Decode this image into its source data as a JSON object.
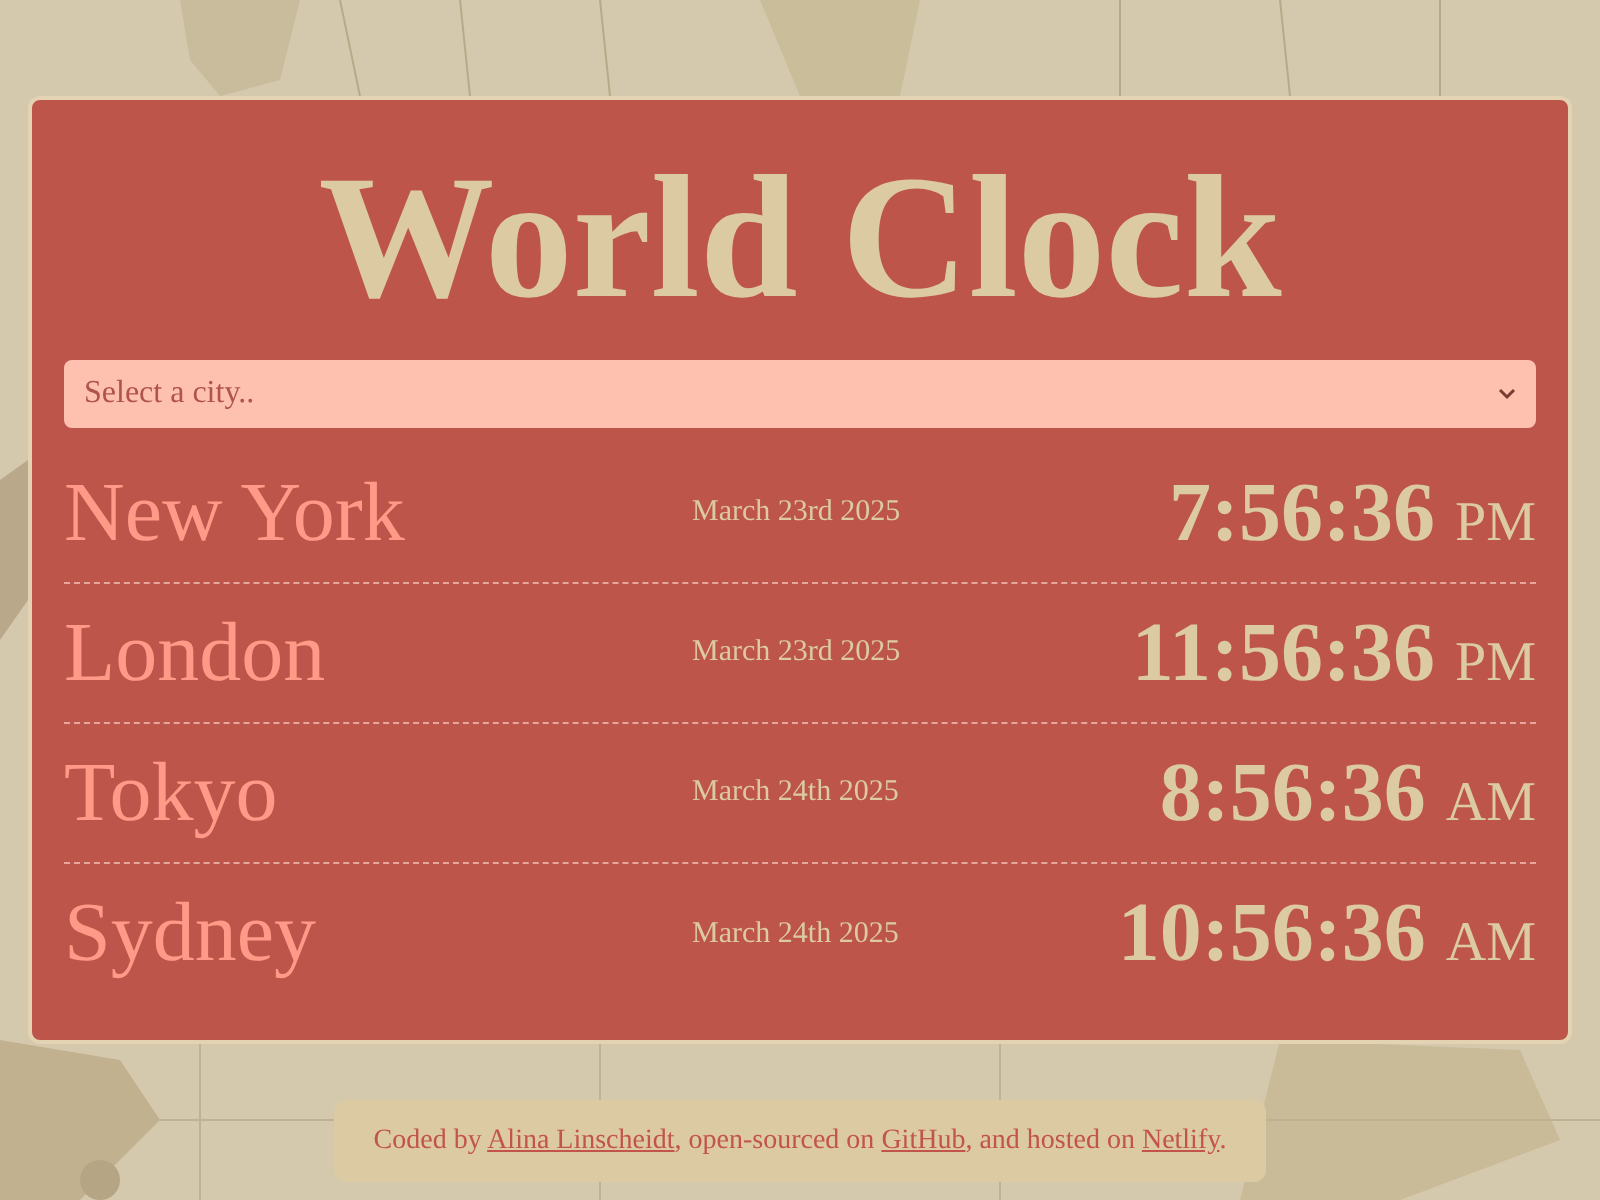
{
  "title": "World Clock",
  "city_select": {
    "placeholder": "Select a city.."
  },
  "cities": [
    {
      "name": "New York",
      "date": "March 23rd 2025",
      "time": "7:56:36",
      "period": "PM"
    },
    {
      "name": "London",
      "date": "March 23rd 2025",
      "time": "11:56:36",
      "period": "PM"
    },
    {
      "name": "Tokyo",
      "date": "March 24th 2025",
      "time": "8:56:36",
      "period": "AM"
    },
    {
      "name": "Sydney",
      "date": "March 24th 2025",
      "time": "10:56:36",
      "period": "AM"
    }
  ],
  "footer": [
    {
      "kind": "text",
      "text": "Coded by "
    },
    {
      "kind": "link",
      "text": "Alina Linscheidt"
    },
    {
      "kind": "text",
      "text": ", open-sourced on "
    },
    {
      "kind": "link",
      "text": "GitHub"
    },
    {
      "kind": "text",
      "text": ", and hosted on "
    },
    {
      "kind": "link",
      "text": "Netlify"
    },
    {
      "kind": "text",
      "text": "."
    }
  ]
}
